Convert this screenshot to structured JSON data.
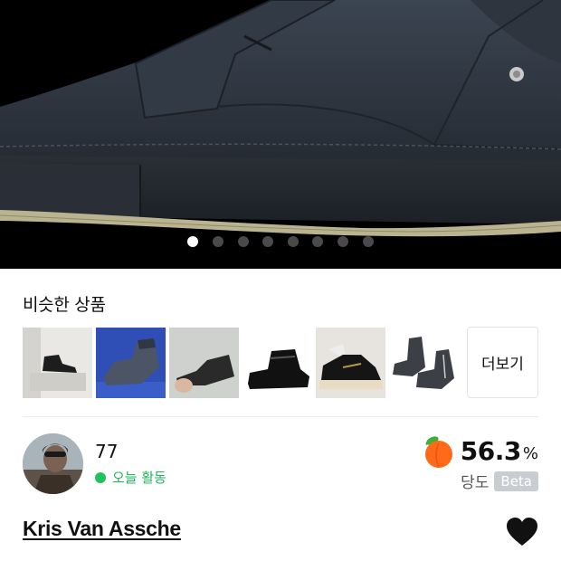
{
  "gallery": {
    "image_desc": "shoe-photo",
    "dot_count": 8,
    "active_index": 0
  },
  "similar": {
    "title": "비슷한 상품",
    "more_label": "더보기",
    "items": [
      {
        "name": "similar-product-1"
      },
      {
        "name": "similar-product-2"
      },
      {
        "name": "similar-product-3"
      },
      {
        "name": "similar-product-4"
      },
      {
        "name": "similar-product-5"
      },
      {
        "name": "similar-product-6"
      }
    ]
  },
  "seller": {
    "name": "77",
    "activity": "오늘 활동",
    "temperature": "56.3",
    "temperature_unit": "%",
    "temperature_label": "당도",
    "beta_label": "Beta",
    "status_color": "#1fc35e"
  },
  "product": {
    "title": "Kris Van Assche",
    "subtitle": ""
  },
  "icons": {
    "heart": "heart-icon",
    "temperature": "peach-icon"
  }
}
